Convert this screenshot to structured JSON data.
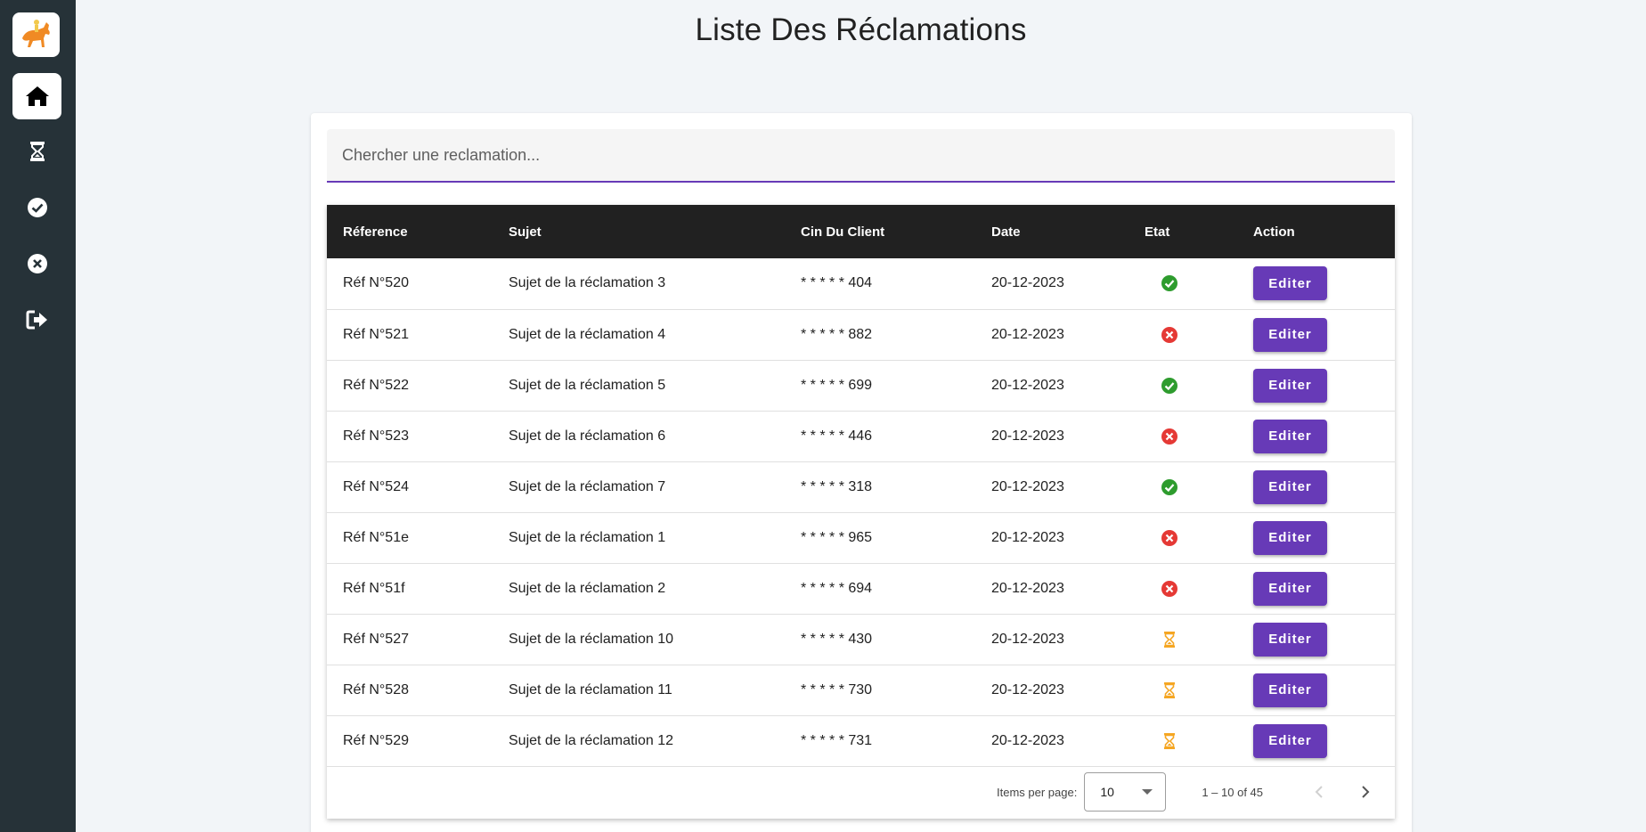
{
  "page": {
    "title": "Liste Des Réclamations"
  },
  "sidebar": {
    "logo": "horse-rider-logo",
    "items": [
      {
        "icon": "home-icon",
        "active": true
      },
      {
        "icon": "hourglass-icon",
        "active": false
      },
      {
        "icon": "check-circle-icon",
        "active": false
      },
      {
        "icon": "x-circle-icon",
        "active": false
      },
      {
        "icon": "logout-icon",
        "active": false
      }
    ]
  },
  "search": {
    "placeholder": "Chercher une reclamation...",
    "value": ""
  },
  "table": {
    "headers": [
      "Réference",
      "Sujet",
      "Cin Du Client",
      "Date",
      "Etat",
      "Action"
    ],
    "rows": [
      {
        "ref": "Réf N°520",
        "sujet": "Sujet de la réclamation 3",
        "cin": "* * * * * 404",
        "date": "20-12-2023",
        "etat": "resolved",
        "action": "Editer"
      },
      {
        "ref": "Réf N°521",
        "sujet": "Sujet de la réclamation 4",
        "cin": "* * * * * 882",
        "date": "20-12-2023",
        "etat": "rejected",
        "action": "Editer"
      },
      {
        "ref": "Réf N°522",
        "sujet": "Sujet de la réclamation 5",
        "cin": "* * * * * 699",
        "date": "20-12-2023",
        "etat": "resolved",
        "action": "Editer"
      },
      {
        "ref": "Réf N°523",
        "sujet": "Sujet de la réclamation 6",
        "cin": "* * * * * 446",
        "date": "20-12-2023",
        "etat": "rejected",
        "action": "Editer"
      },
      {
        "ref": "Réf N°524",
        "sujet": "Sujet de la réclamation 7",
        "cin": "* * * * * 318",
        "date": "20-12-2023",
        "etat": "resolved",
        "action": "Editer"
      },
      {
        "ref": "Réf N°51e",
        "sujet": "Sujet de la réclamation 1",
        "cin": "* * * * * 965",
        "date": "20-12-2023",
        "etat": "rejected",
        "action": "Editer"
      },
      {
        "ref": "Réf N°51f",
        "sujet": "Sujet de la réclamation 2",
        "cin": "* * * * * 694",
        "date": "20-12-2023",
        "etat": "rejected",
        "action": "Editer"
      },
      {
        "ref": "Réf N°527",
        "sujet": "Sujet de la réclamation 10",
        "cin": "* * * * * 430",
        "date": "20-12-2023",
        "etat": "pending",
        "action": "Editer"
      },
      {
        "ref": "Réf N°528",
        "sujet": "Sujet de la réclamation 11",
        "cin": "* * * * * 730",
        "date": "20-12-2023",
        "etat": "pending",
        "action": "Editer"
      },
      {
        "ref": "Réf N°529",
        "sujet": "Sujet de la réclamation 12",
        "cin": "* * * * * 731",
        "date": "20-12-2023",
        "etat": "pending",
        "action": "Editer"
      }
    ]
  },
  "paginator": {
    "items_per_page_label": "Items per page:",
    "page_size": "10",
    "range_label": "1 – 10 of 45"
  },
  "colors": {
    "accent": "#673ab7",
    "sidebar_bg": "#263238",
    "header_bg": "#212121",
    "resolved": "#2e9c2e",
    "rejected": "#e53935",
    "pending": "#f5a623"
  }
}
